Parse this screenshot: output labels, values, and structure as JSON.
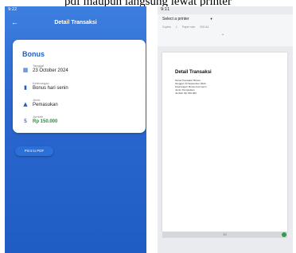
{
  "caption": "pdf maupun langsung lewat printer",
  "left": {
    "status_time": "9:22",
    "back_icon": "arrow-left-icon",
    "title": "Detail Transaksi",
    "card": {
      "heading": "Bonus",
      "rows": [
        {
          "icon": "calendar-icon",
          "label": "Tanggal",
          "value": "23 October 2024"
        },
        {
          "icon": "document-icon",
          "label": "Keterangan",
          "value": "Bonus hari senin"
        },
        {
          "icon": "category-icon",
          "label": "Jenis",
          "value": "Pemasukan"
        },
        {
          "icon": "money-icon",
          "label": "Jumlah",
          "value": "Rp 150.000"
        }
      ]
    },
    "print_button": "Print to PDF",
    "colors": {
      "primary": "#2b6fd9",
      "amount": "#2e8b3e"
    }
  },
  "right": {
    "status_time": "9:11",
    "printer_select": "Select a printer",
    "copies_label": "Copies",
    "copies_value": "1",
    "paper_label": "Paper size",
    "paper_value": "ISO A4",
    "doc_title": "Detail Transaksi",
    "doc_lines": [
      "Nama Transaksi: Bonus",
      "Tanggal: 23 September 2024",
      "Keterangan: Bonus hari senin",
      "Jenis: Pemasukan",
      "Jumlah: Rp 150.000"
    ],
    "page_indicator": "1/1"
  }
}
